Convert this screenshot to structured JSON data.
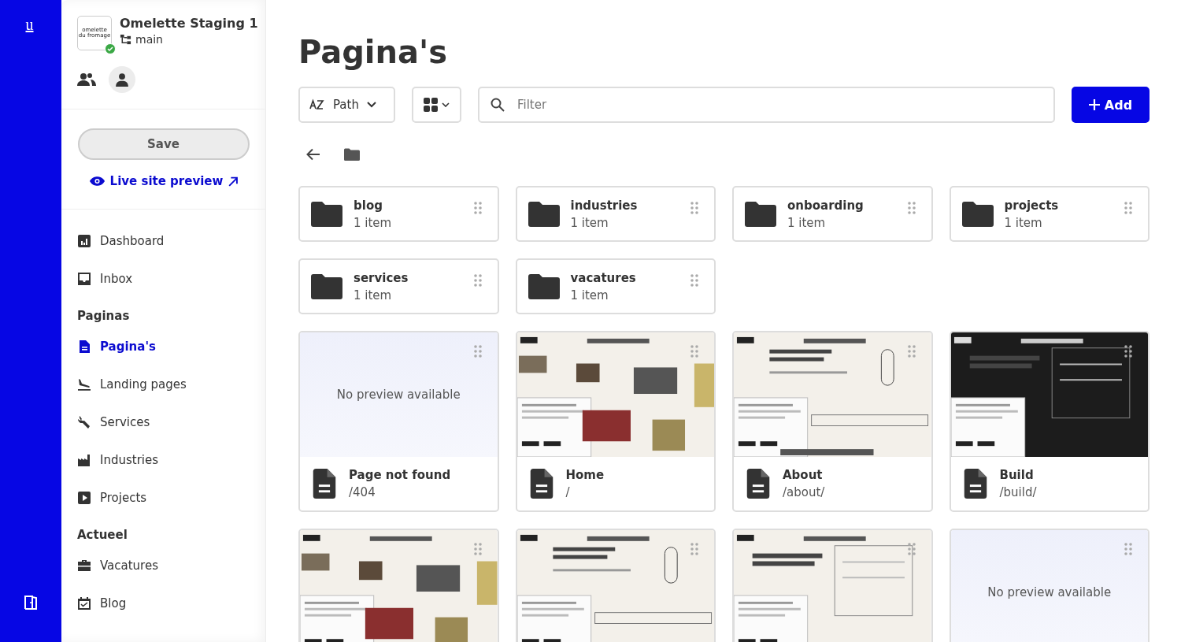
{
  "rail": {
    "logo": "u"
  },
  "site": {
    "name": "Omelette Staging 1",
    "branch": "main",
    "logo_lines": [
      "omelette",
      "du fromage"
    ],
    "online": true
  },
  "save_button": "Save",
  "live_preview": "Live site preview",
  "nav": [
    {
      "kind": "item",
      "label": "Dashboard",
      "selected": false
    },
    {
      "kind": "item",
      "label": "Inbox",
      "selected": false
    },
    {
      "kind": "heading",
      "label": "Paginas"
    },
    {
      "kind": "item",
      "label": "Pagina's",
      "selected": true
    },
    {
      "kind": "item",
      "label": "Landing pages",
      "selected": false
    },
    {
      "kind": "item",
      "label": "Services",
      "selected": false
    },
    {
      "kind": "item",
      "label": "Industries",
      "selected": false
    },
    {
      "kind": "item",
      "label": "Projects",
      "selected": false
    },
    {
      "kind": "heading",
      "label": "Actueel"
    },
    {
      "kind": "item",
      "label": "Vacatures",
      "selected": false
    },
    {
      "kind": "item",
      "label": "Blog",
      "selected": false
    }
  ],
  "page_title": "Pagina's",
  "toolbar": {
    "sort": "Path",
    "filter_placeholder": "Filter",
    "add_button": "Add"
  },
  "folders": [
    {
      "name": "blog",
      "count": "1 item"
    },
    {
      "name": "industries",
      "count": "1 item"
    },
    {
      "name": "onboarding",
      "count": "1 item"
    },
    {
      "name": "projects",
      "count": "1 item"
    },
    {
      "name": "services",
      "count": "1 item"
    },
    {
      "name": "vacatures",
      "count": "1 item"
    }
  ],
  "pages": [
    {
      "kind": "empty",
      "preview_text": "No preview available",
      "title": "Page not found",
      "path": "/404"
    },
    {
      "kind": "picture",
      "title": "Home",
      "path": "/"
    },
    {
      "kind": "picture",
      "title": "About",
      "path": "/about/"
    },
    {
      "kind": "picture",
      "title": "Build",
      "path": "/build/"
    },
    {
      "kind": "picture"
    },
    {
      "kind": "picture"
    },
    {
      "kind": "picture"
    },
    {
      "kind": "empty",
      "preview_text": "No preview available"
    }
  ]
}
